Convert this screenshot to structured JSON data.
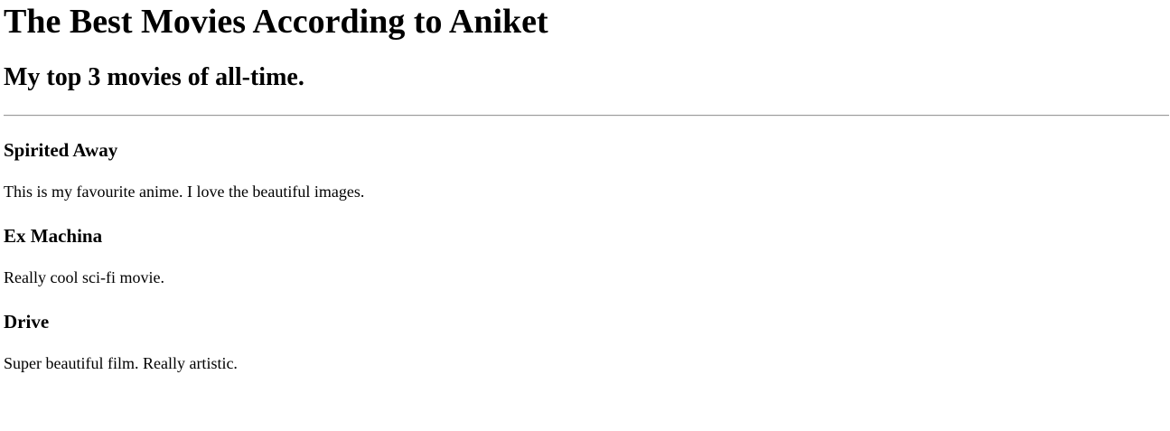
{
  "page": {
    "title": "The Best Movies According to Aniket",
    "subtitle": "My top 3 movies of all-time."
  },
  "movies": [
    {
      "name": "Spirited Away",
      "description": "This is my favourite anime. I love the beautiful images."
    },
    {
      "name": "Ex Machina",
      "description": "Really cool sci-fi movie."
    },
    {
      "name": "Drive",
      "description": "Super beautiful film. Really artistic."
    }
  ]
}
